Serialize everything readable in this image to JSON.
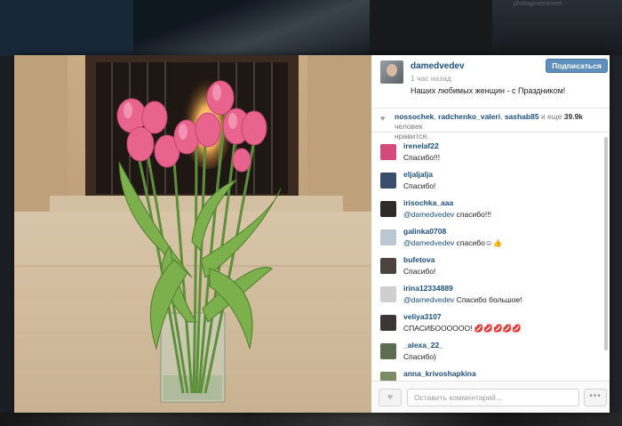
{
  "background": {
    "topbar_label": "photogovernment"
  },
  "post": {
    "author": "damedvedev",
    "time": "1 час назад",
    "caption": "Наших любимых женщин - с Праздником!",
    "follow_label": "Подписаться",
    "photo_icon": "tulips-photo"
  },
  "likes": {
    "heart_icon": "heart-icon",
    "users": [
      "nossochek",
      "radchenko_valeri",
      "sashab85"
    ],
    "sep": ", ",
    "and_more": " и еще ",
    "count": "39.9k",
    "suffix": " человек",
    "line2": "нравится."
  },
  "comments": [
    {
      "user": "irenelaf22",
      "mention": "",
      "text": "Спасибо!!!",
      "avatar_color": "#d24b7a"
    },
    {
      "user": "eljaljalja",
      "mention": "",
      "text": "Спасибо!",
      "avatar_color": "#3a4e6b"
    },
    {
      "user": "irisochka_aaa",
      "mention": "@damedvedev",
      "text": " спасибо!!!",
      "avatar_color": "#2f2b2a"
    },
    {
      "user": "galinka0708",
      "mention": "@damedvedev",
      "text": " спасибо☺👍",
      "avatar_color": "#b9c7d3"
    },
    {
      "user": "bufetova",
      "mention": "",
      "text": "Спасибо!",
      "avatar_color": "#4a4340"
    },
    {
      "user": "irina12334889",
      "mention": "@damedvedev",
      "text": " Спасибо большое!",
      "avatar_color": "#cfcfcf"
    },
    {
      "user": "veliya3107",
      "mention": "",
      "text": "СПАСИБОООООО! 💋💋💋💋💋",
      "avatar_color": "#3c3634"
    },
    {
      "user": "_alexa_22_",
      "mention": "",
      "text": "Спасибо)",
      "avatar_color": "#5c6d52"
    },
    {
      "user": "anna_krivoshapkina",
      "mention": "",
      "text": "",
      "avatar_color": "#7a8a63"
    }
  ],
  "footer": {
    "like_icon": "heart-icon",
    "comment_placeholder": "Оставить комментарий...",
    "more_label": "•••"
  },
  "colors": {
    "link": "#1c4f7e",
    "follow_button": "#5e8fbd",
    "tulip": "#e8638e"
  }
}
